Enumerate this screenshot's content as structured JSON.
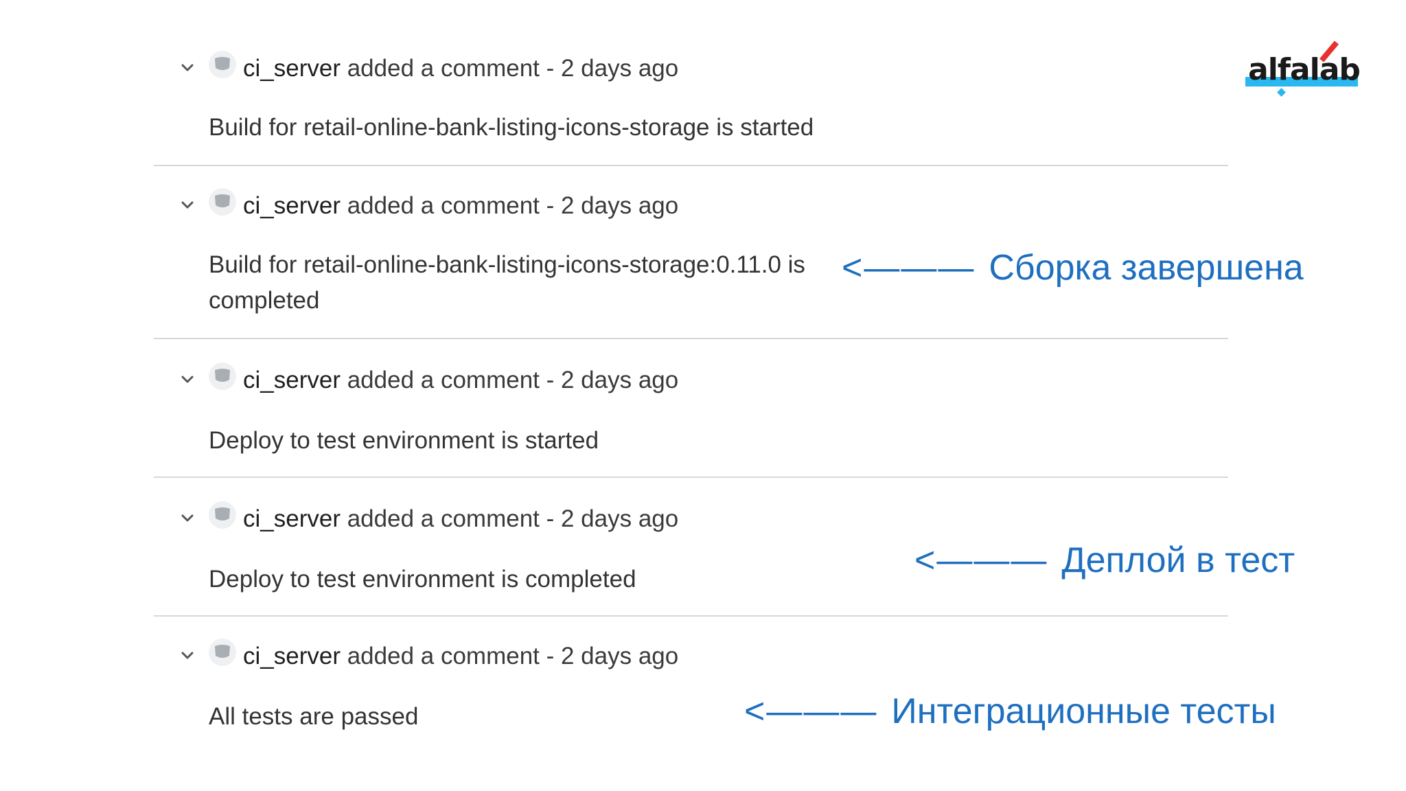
{
  "logo": {
    "text": "alfalab"
  },
  "comments": [
    {
      "author": "ci_server",
      "meta": " added a comment - 2 days ago",
      "body": "Build for retail-online-bank-listing-icons-storage is started"
    },
    {
      "author": "ci_server",
      "meta": " added a comment - 2 days ago",
      "body": "Build for retail-online-bank-listing-icons-storage:0.11.0 is completed"
    },
    {
      "author": "ci_server",
      "meta": " added a comment - 2 days ago",
      "body": "Deploy to test environment is started"
    },
    {
      "author": "ci_server",
      "meta": " added a comment - 2 days ago",
      "body": "Deploy to test environment is completed"
    },
    {
      "author": "ci_server",
      "meta": " added a comment - 2 days ago",
      "body": "All tests are passed"
    }
  ],
  "annotations": [
    {
      "arrow": "<———",
      "text": "Сборка завершена"
    },
    {
      "arrow": "<———",
      "text": "Деплой в тест"
    },
    {
      "arrow": "<———",
      "text": "Интеграционные тесты"
    }
  ],
  "colors": {
    "annotation": "#1e6fc0",
    "separator": "#d8d8d8",
    "logo_accent_blue": "#29b8f0",
    "logo_accent_red": "#e8312f"
  },
  "icons": {
    "collapse": "chevron-down-icon",
    "avatar": "user-avatar-icon"
  }
}
